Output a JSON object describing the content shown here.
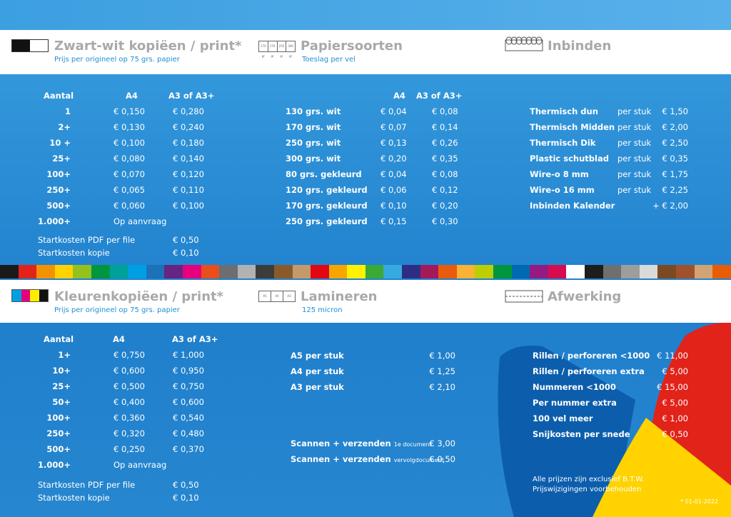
{
  "bw": {
    "title": "Zwart-wit kopiëen / print*",
    "subtitle": "Prijs per origineel op 75 grs. papier",
    "headers": [
      "Aantal",
      "A4",
      "A3 of A3+"
    ],
    "rows": [
      [
        "1",
        "€ 0,150",
        "€ 0,280"
      ],
      [
        "2+",
        "€ 0,130",
        "€ 0,240"
      ],
      [
        "10 +",
        "€ 0,100",
        "€ 0,180"
      ],
      [
        "25+",
        "€ 0,080",
        "€ 0,140"
      ],
      [
        "100+",
        "€ 0,070",
        "€ 0,120"
      ],
      [
        "250+",
        "€ 0,065",
        "€ 0,110"
      ],
      [
        "500+",
        "€ 0,060",
        "€ 0,100"
      ],
      [
        "1.000+",
        "Op aanvraag",
        ""
      ]
    ],
    "start": [
      [
        "Startkosten PDF per file",
        "€ 0,50"
      ],
      [
        "Startkosten kopie",
        "€ 0,10"
      ]
    ]
  },
  "paper": {
    "title": "Papiersoorten",
    "subtitle": "Toeslag per vel",
    "icon_labels": [
      "170 gr",
      "170 gr",
      "250 gr",
      "300 gr"
    ],
    "headers": [
      "A4",
      "A3 of A3+"
    ],
    "rows": [
      [
        "130 grs. wit",
        "€ 0,04",
        "€ 0,08"
      ],
      [
        "170 grs. wit",
        "€ 0,07",
        "€ 0,14"
      ],
      [
        "250 grs. wit",
        "€ 0,13",
        "€ 0,26"
      ],
      [
        "300 grs. wit",
        "€ 0,20",
        "€ 0,35"
      ],
      [
        "80 grs. gekleurd",
        "€ 0,04",
        "€ 0,08"
      ],
      [
        "120 grs. gekleurd",
        "€ 0,06",
        "€ 0,12"
      ],
      [
        "170 grs. gekleurd",
        "€ 0,10",
        "€ 0,20"
      ],
      [
        "250 grs. gekleurd",
        "€ 0,15",
        "€ 0,30"
      ]
    ]
  },
  "binding": {
    "title": "Inbinden",
    "rows": [
      [
        "Thermisch dun",
        "per stuk",
        "€ 1,50"
      ],
      [
        "Thermisch Midden",
        "per stuk",
        "€ 2,00"
      ],
      [
        "Thermisch Dik",
        "per stuk",
        "€ 2,50"
      ],
      [
        "Plastic schutblad",
        "per stuk",
        "€ 0,35"
      ],
      [
        "Wire-o 8 mm",
        "per stuk",
        "€ 1,75"
      ],
      [
        "Wire-o 16 mm",
        "per stuk",
        "€ 2,25"
      ],
      [
        "Inbinden Kalender",
        "",
        "+ € 2,00"
      ]
    ]
  },
  "color": {
    "title": "Kleurenkopiëen / print*",
    "subtitle": "Prijs per origineel op 75 grs. papier",
    "headers": [
      "Aantal",
      "A4",
      "A3 of A3+"
    ],
    "rows": [
      [
        "1+",
        "€ 0,750",
        "€ 1,000"
      ],
      [
        "10+",
        "€ 0,600",
        "€ 0,950"
      ],
      [
        "25+",
        "€ 0,500",
        "€ 0,750"
      ],
      [
        "50+",
        "€ 0,400",
        "€ 0,600"
      ],
      [
        "100+",
        "€ 0,360",
        "€ 0,540"
      ],
      [
        "250+",
        "€ 0,320",
        "€ 0,480"
      ],
      [
        "500+",
        "€ 0,250",
        "€ 0,370"
      ],
      [
        "1.000+",
        "Op aanvraag",
        ""
      ]
    ],
    "start": [
      [
        "Startkosten PDF per file",
        "€ 0,50"
      ],
      [
        "Startkosten kopie",
        "€ 0,10"
      ]
    ]
  },
  "laminate": {
    "title": "Lamineren",
    "subtitle": "125 micron",
    "icon_labels": [
      "A5",
      "A4",
      "A3"
    ],
    "rows": [
      [
        "A5 per stuk",
        "€ 1,00"
      ],
      [
        "A4 per stuk",
        "€ 1,25"
      ],
      [
        "A3 per stuk",
        "€ 2,10"
      ]
    ],
    "scan": [
      {
        "label": "Scannen + verzenden",
        "small": "1e document",
        "price": "€ 3,00"
      },
      {
        "label": "Scannen + verzenden",
        "small": "vervolgdocument",
        "price": "€ 0,50"
      }
    ]
  },
  "finish": {
    "title": "Afwerking",
    "rows": [
      [
        "Rillen / perforeren <1000",
        "€ 11,00"
      ],
      [
        "Rillen / perforeren extra",
        "€ 5,00"
      ],
      [
        "Nummeren <1000",
        "€ 15,00"
      ],
      [
        "Per nummer extra",
        "€ 5,00"
      ],
      [
        "100 vel meer",
        "€ 1,00"
      ],
      [
        "Snijkosten per snede",
        "€ 0,50"
      ]
    ],
    "notes": [
      "Alle prijzen zijn exclusief B.T.W.",
      "Prijswijzigingen voorbehouden"
    ],
    "date": "* 01-01-2022"
  },
  "colors": {
    "title_gray": "#a9a9a9",
    "subtitle_blue": "#1e8fd6",
    "shape_red": "#e2231a",
    "shape_yellow": "#ffd200",
    "shape_blue": "#0a5aa8"
  }
}
